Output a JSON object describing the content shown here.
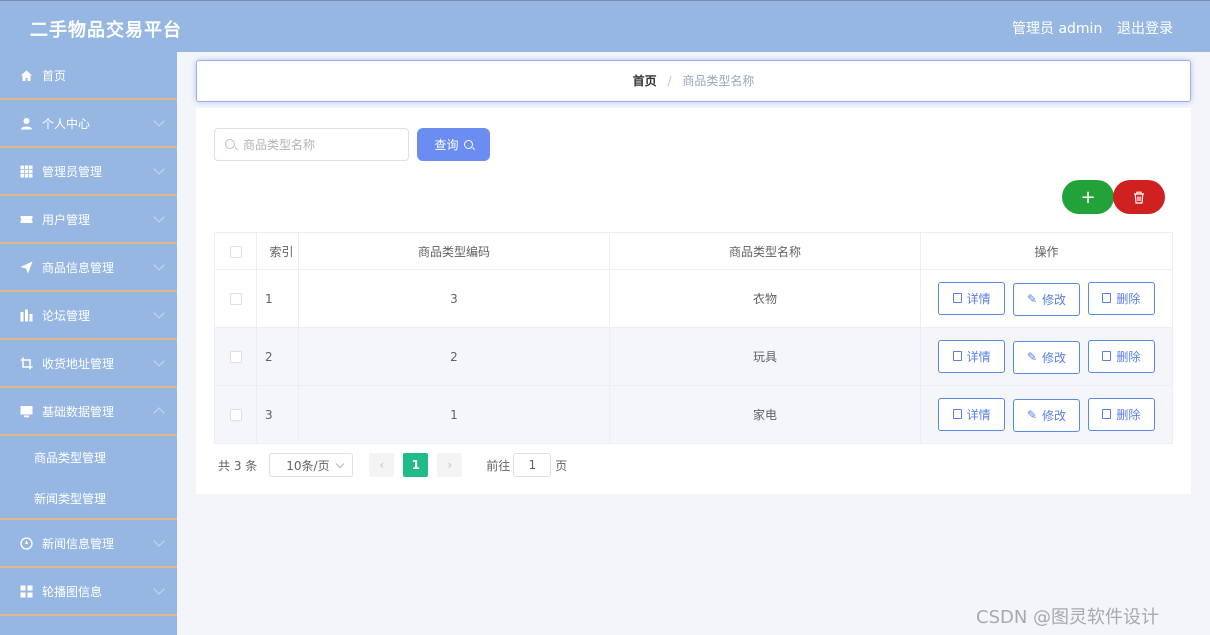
{
  "header": {
    "brand": "二手物品交易平台",
    "admin": "管理员 admin",
    "logout": "退出登录"
  },
  "sidebar": {
    "items": [
      {
        "label": "首页",
        "icon": "home-icon"
      },
      {
        "label": "个人中心",
        "icon": "user-icon"
      },
      {
        "label": "管理员管理",
        "icon": "grid-icon"
      },
      {
        "label": "用户管理",
        "icon": "ticket-icon"
      },
      {
        "label": "商品信息管理",
        "icon": "send-icon"
      },
      {
        "label": "论坛管理",
        "icon": "chart-icon"
      },
      {
        "label": "收货地址管理",
        "icon": "crop-icon"
      },
      {
        "label": "基础数据管理",
        "icon": "monitor-icon"
      },
      {
        "label": "新闻信息管理",
        "icon": "compass-icon"
      },
      {
        "label": "轮播图信息",
        "icon": "apps-icon"
      }
    ],
    "subitems": [
      "商品类型管理",
      "新闻类型管理"
    ]
  },
  "breadcrumb": {
    "home": "首页",
    "separator": "/",
    "current": "商品类型名称"
  },
  "search": {
    "placeholder": "商品类型名称",
    "button": "查询"
  },
  "actions": {
    "add": "+"
  },
  "table": {
    "headers": [
      "索引",
      "商品类型编码",
      "商品类型名称",
      "操作"
    ],
    "rows": [
      {
        "index": "1",
        "code": "3",
        "name": "衣物"
      },
      {
        "index": "2",
        "code": "2",
        "name": "玩具"
      },
      {
        "index": "3",
        "code": "1",
        "name": "家电"
      }
    ],
    "ops": {
      "detail": "详情",
      "edit": "修改",
      "delete": "删除"
    }
  },
  "pager": {
    "total": "共 3 条",
    "page_size": "10条/页",
    "prev": "‹",
    "current": "1",
    "next": "›",
    "goto": "前往",
    "goto_value": "1",
    "page_unit": "页"
  },
  "watermark": "CSDN @图灵软件设计",
  "colors": {
    "sidebar_bg": "#97b7e3",
    "primary": "#6b8cf0",
    "add_green": "#23a23a",
    "delete_red": "#d02020",
    "page_active": "#1fbc8a"
  }
}
